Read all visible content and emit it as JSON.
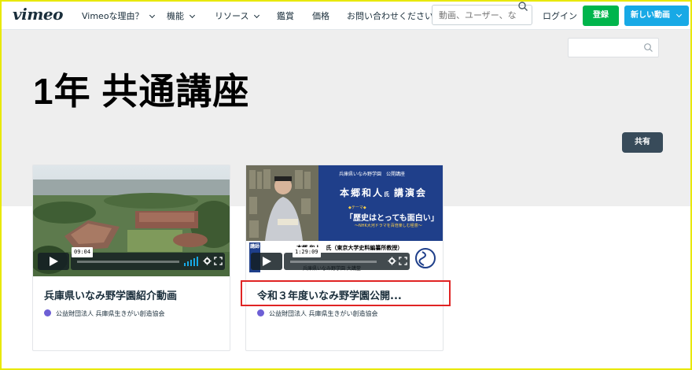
{
  "nav": {
    "logo": "vimeo",
    "items": [
      {
        "label": "Vimeoな理由？"
      },
      {
        "label": "機能"
      },
      {
        "label": "リソース"
      },
      {
        "label": "鑑賞"
      },
      {
        "label": "価格"
      },
      {
        "label": "お問い合わせください"
      }
    ],
    "search_placeholder": "動画、ユーザー、な",
    "login": "ログイン",
    "register": "登録",
    "new_video": "新しい動画"
  },
  "banner": {
    "title": "1年 共通講座",
    "share": "共有"
  },
  "cards": [
    {
      "title": "兵庫県いなみ野学園紹介動画",
      "owner": "公益財団法人 兵庫県生きがい創造協会",
      "duration": "09:04"
    },
    {
      "title": "令和３年度いなみ野学園公開...",
      "owner": "公益財団法人 兵庫県生きがい創造協会",
      "duration": "1:29:09",
      "thumb_text": {
        "header": "兵庫県いなみ野学園　公開講座",
        "speaker": "本郷和人",
        "suffix": "氏",
        "event": "講演会",
        "theme_label": "◆テーマ◆",
        "theme": "「歴史はとっても面白い」",
        "subtheme": "～NHK大河ドラマを百倍楽しむ極意～",
        "caption": "本郷 和人　氏（東京大学史料編纂所教授）",
        "caption2": "兵庫県いなみ野学園 大講堂",
        "side": "講師"
      }
    }
  ],
  "colors": {
    "green": "#00b54c",
    "blue": "#17a9e6",
    "share": "#384b5a",
    "highlight": "#e02424"
  }
}
